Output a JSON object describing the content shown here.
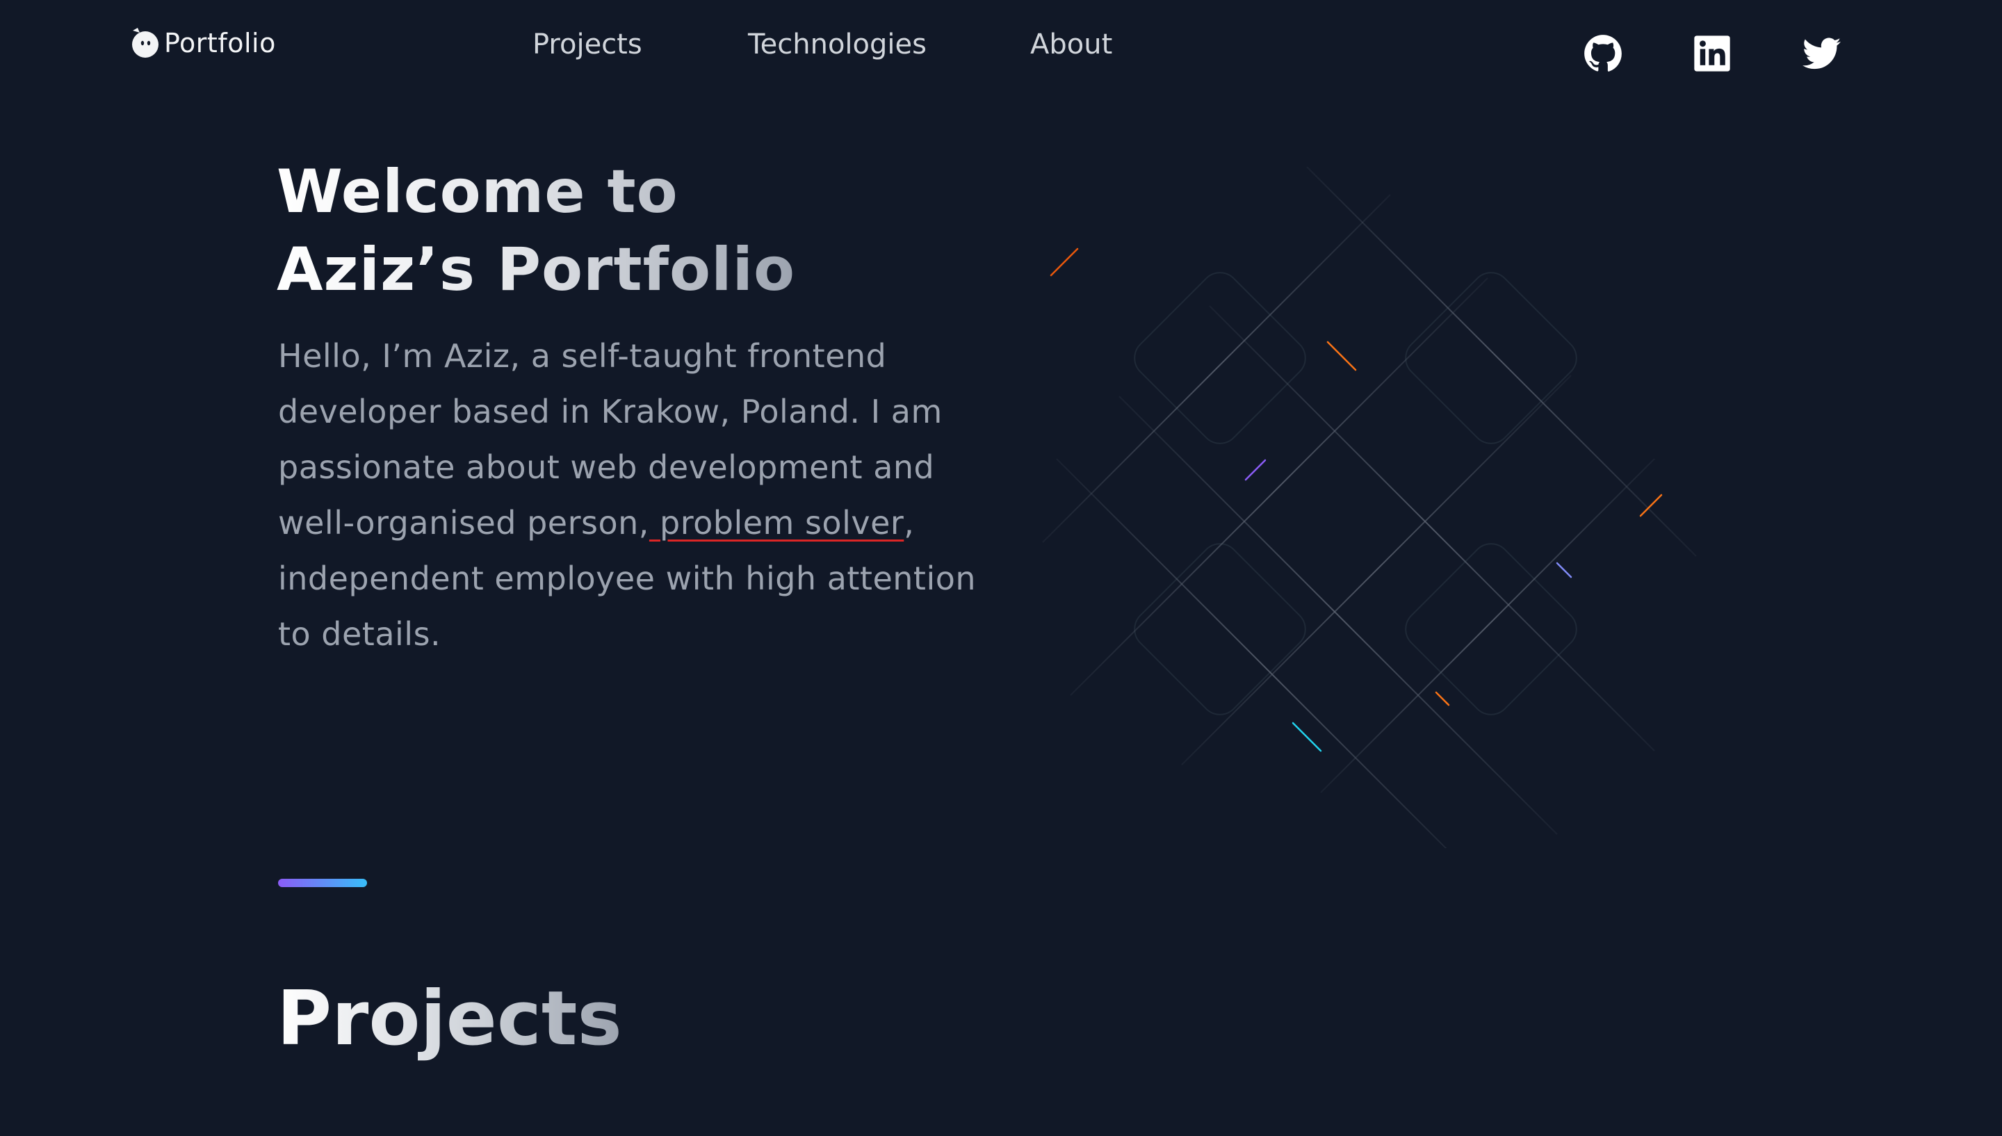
{
  "header": {
    "logo_text": "Portfolio",
    "nav": [
      {
        "label": "Projects"
      },
      {
        "label": "Technologies"
      },
      {
        "label": "About"
      }
    ],
    "social": [
      {
        "icon": "github-icon"
      },
      {
        "icon": "linkedin-icon"
      },
      {
        "icon": "twitter-icon"
      }
    ]
  },
  "hero": {
    "title_line1": "Welcome to",
    "title_line2": "Aziz’s Portfolio",
    "intro_before": "Hello, I’m Aziz, a self-taught frontend developer based in Krakow, Poland. I am passionate about web development and well-organised person,",
    "intro_highlight": " problem solver",
    "intro_after": ", independent employee with high attention to details."
  },
  "projects_section": {
    "title": "Projects"
  },
  "colors": {
    "background": "#111827",
    "text_primary": "#f3f4f6",
    "text_muted": "#9ca3af",
    "accent_gradient_start": "#8b5cf6",
    "accent_gradient_end": "#38bdf8",
    "spellcheck_underline": "#dc2626"
  }
}
